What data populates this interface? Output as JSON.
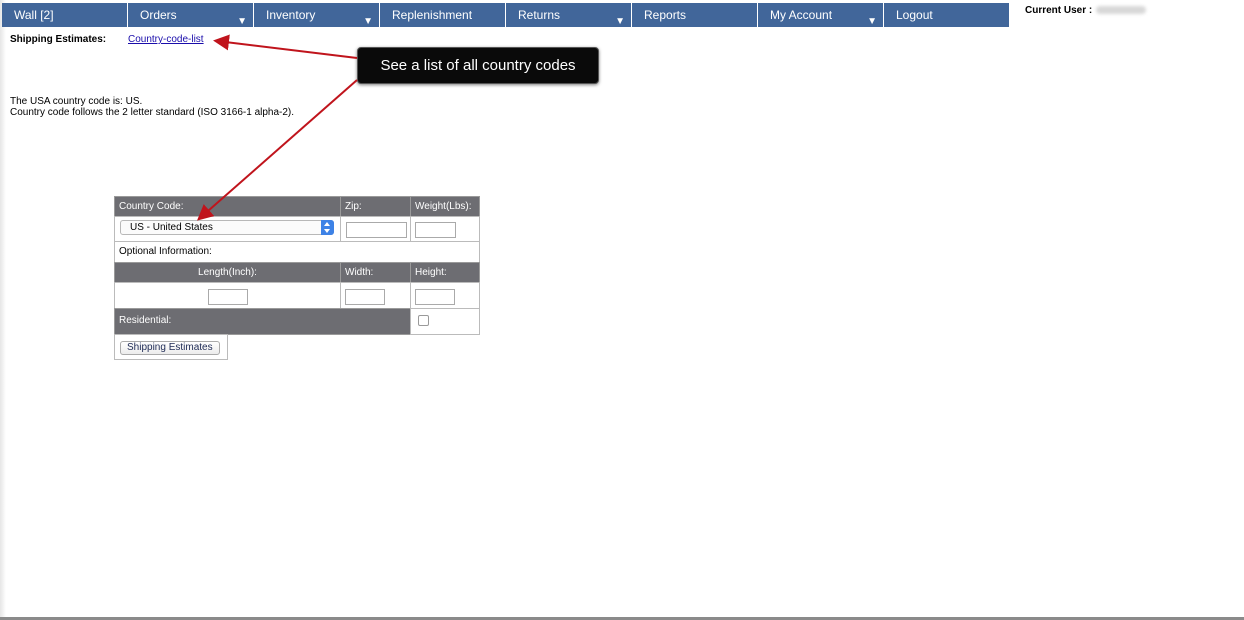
{
  "nav": {
    "items": [
      {
        "label": "Wall [2]",
        "has_dropdown": false
      },
      {
        "label": "Orders",
        "has_dropdown": true
      },
      {
        "label": "Inventory",
        "has_dropdown": true
      },
      {
        "label": "Replenishment",
        "has_dropdown": false
      },
      {
        "label": "Returns",
        "has_dropdown": true
      },
      {
        "label": "Reports",
        "has_dropdown": false
      },
      {
        "label": "My Account",
        "has_dropdown": true
      },
      {
        "label": "Logout",
        "has_dropdown": false
      }
    ],
    "dropdown_glyph": "▼",
    "bar_color": "#41669a"
  },
  "current_user_label": "Current User :",
  "shipping": {
    "label": "Shipping Estimates:",
    "link_text": "Country-code-list"
  },
  "callout": {
    "text": "See a list of all country codes"
  },
  "info": {
    "line1": "The USA country code is: US.",
    "line2": "Country code follows the 2 letter standard (ISO 3166-1 alpha-2)."
  },
  "form": {
    "country_code_header": "Country Code:",
    "zip_header": "Zip:",
    "weight_header": "Weight(Lbs):",
    "country_selected": "US - United States",
    "zip_value": "",
    "weight_value": "",
    "optional_label": "Optional Information:",
    "length_header": "Length(Inch):",
    "width_header": "Width:",
    "height_header": "Height:",
    "length_value": "",
    "width_value": "",
    "height_value": "",
    "residential_label": "Residential:",
    "residential_checked": false,
    "submit_label": "Shipping Estimates"
  },
  "colors": {
    "annotation_arrow": "#c0141c",
    "header_bg": "#6d6d72"
  }
}
